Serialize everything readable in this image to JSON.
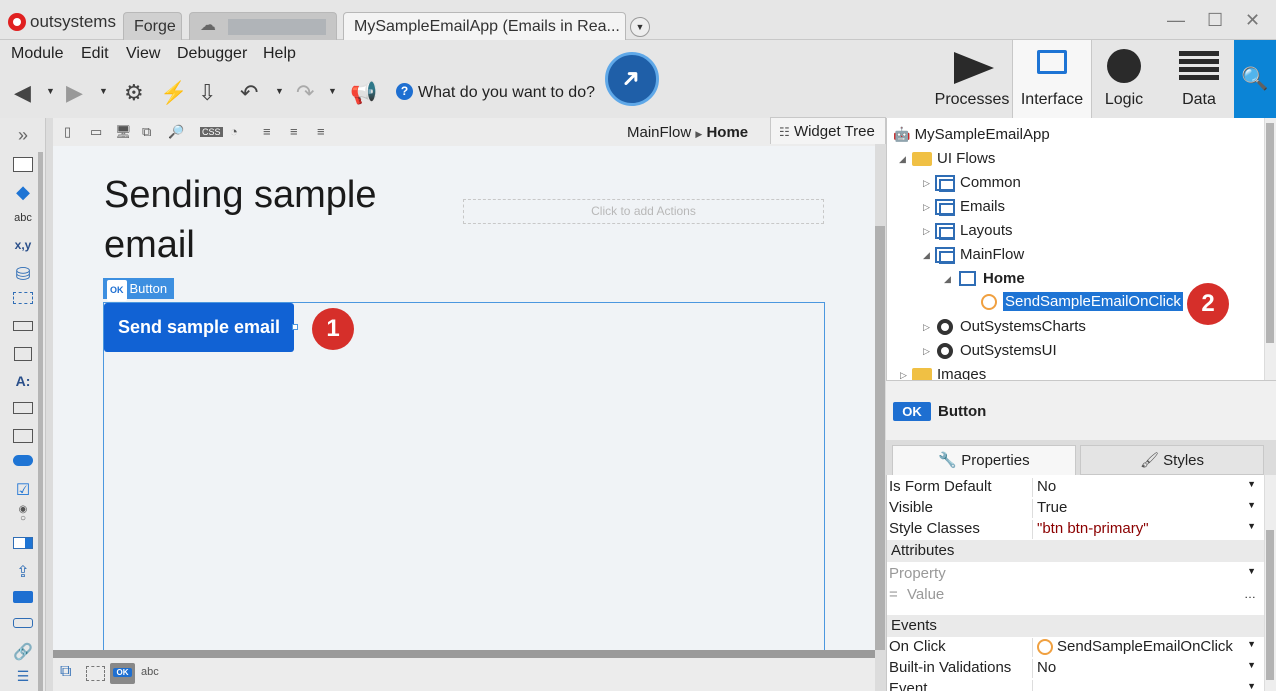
{
  "titlebar": {
    "brand": "outsystems",
    "tabs": [
      "Forge",
      "",
      "MySampleEmailApp (Emails in Rea..."
    ],
    "controls": [
      "—",
      "☐",
      "✕"
    ]
  },
  "menu": [
    "Module",
    "Edit",
    "View",
    "Debugger",
    "Help"
  ],
  "toolbar": {
    "help_text": "What do you want to do?"
  },
  "right_tabs": [
    "Processes",
    "Interface",
    "Logic",
    "Data"
  ],
  "canvas": {
    "breadcrumb_flow": "MainFlow",
    "breadcrumb_screen": "Home",
    "title": "Sending sample email",
    "actions_placeholder": "Click to add Actions",
    "widget_tag": "Button",
    "widget_tag_ok": "OK",
    "button_label": "Send sample email"
  },
  "badges": [
    "1",
    "2"
  ],
  "widget_tree_tab": "Widget Tree",
  "tree": {
    "app": "MySampleEmailApp",
    "ui_flows": "UI Flows",
    "flows": [
      "Common",
      "Emails",
      "Layouts",
      "MainFlow"
    ],
    "screen": "Home",
    "action": "SendSampleEmailOnClick",
    "modules": [
      "OutSystemsCharts",
      "OutSystemsUI"
    ],
    "images": "Images"
  },
  "properties": {
    "ok": "OK",
    "widget_name": "Button",
    "tabs": [
      "Properties",
      "Styles"
    ],
    "rows": [
      {
        "key": "Is Form Default",
        "value": "No"
      },
      {
        "key": "Visible",
        "value": "True"
      },
      {
        "key": "Style Classes",
        "value": "\"btn btn-primary\""
      }
    ],
    "attributes_section": "Attributes",
    "attr_property_placeholder": "Property",
    "attr_value_placeholder": "Value",
    "events_section": "Events",
    "events": [
      {
        "key": "On Click",
        "value": "SendSampleEmailOnClick"
      },
      {
        "key": "Built-in Validations",
        "value": "No"
      },
      {
        "key": "Event",
        "value": ""
      }
    ]
  },
  "palette_text": {
    "abc": "abc",
    "xy": "x,y",
    "a": "A:"
  },
  "bottom_abc": "abc",
  "colors": {
    "accent": "#1162d4",
    "badge": "#d62f2a",
    "search": "#0b84d6"
  }
}
